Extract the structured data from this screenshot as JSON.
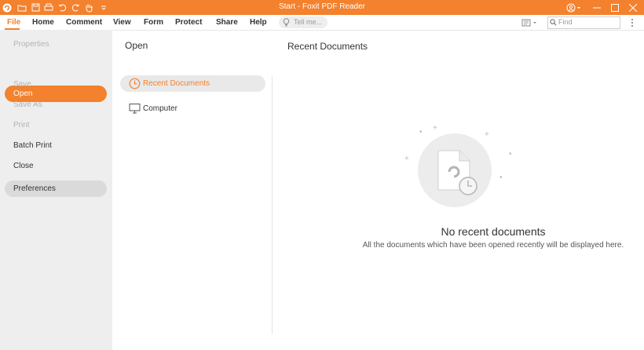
{
  "window": {
    "title": "Start - Foxit PDF Reader"
  },
  "menu": {
    "items": [
      "File",
      "Home",
      "Comment",
      "View",
      "Form",
      "Protect",
      "Share",
      "Help"
    ],
    "tell_me_placeholder": "Tell me...",
    "find_placeholder": "Find"
  },
  "backstage": {
    "items": [
      {
        "label": "Properties",
        "state": "disabled"
      },
      {
        "label": "Open",
        "state": "selected"
      },
      {
        "label": "Save",
        "state": "disabled"
      },
      {
        "label": "Save As",
        "state": "disabled"
      },
      {
        "label": "Print",
        "state": "disabled"
      },
      {
        "label": "Batch Print",
        "state": "normal"
      },
      {
        "label": "Close",
        "state": "normal"
      },
      {
        "label": "Preferences",
        "state": "normal"
      }
    ]
  },
  "open_panel": {
    "title": "Open",
    "options": [
      "Recent Documents",
      "Computer"
    ]
  },
  "recent": {
    "title": "Recent Documents",
    "empty_title": "No recent documents",
    "empty_message": "All the documents which have been opened recently will be displayed here."
  },
  "colors": {
    "accent": "#f3812d"
  }
}
